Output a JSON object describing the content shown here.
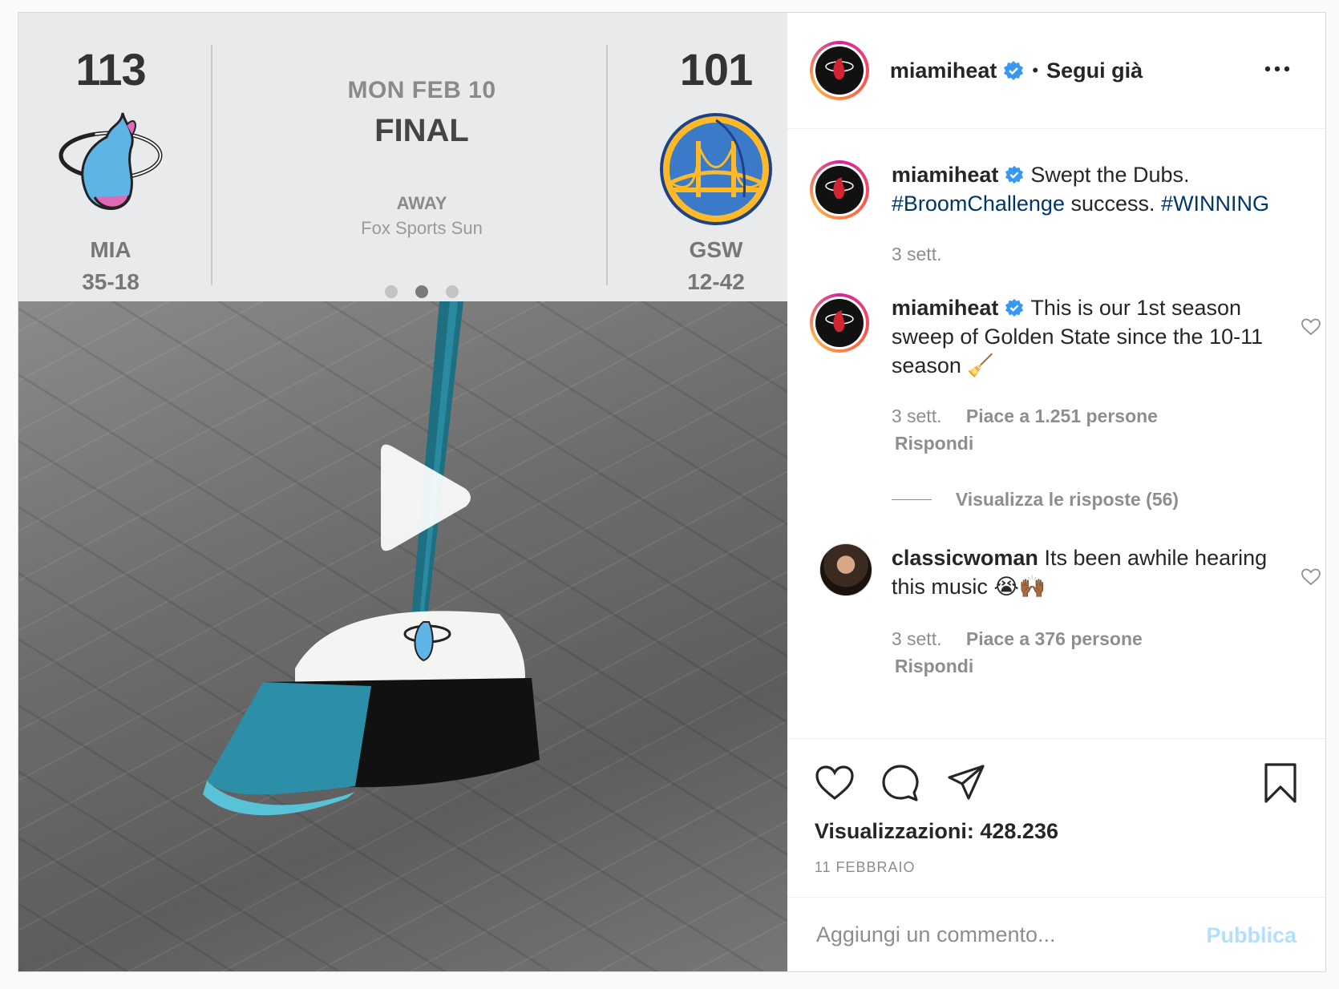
{
  "scoreboard": {
    "home": {
      "score": "113",
      "abbr": "MIA",
      "record": "35-18"
    },
    "away": {
      "score": "101",
      "abbr": "GSW",
      "record": "12-42"
    },
    "date": "MON FEB 10",
    "status": "FINAL",
    "location": "AWAY",
    "tv": "Fox Sports Sun",
    "carousel": {
      "count": 3,
      "active_index": 1
    }
  },
  "header": {
    "username": "miamiheat",
    "separator": "•",
    "follow_label": "Segui già"
  },
  "caption": {
    "username": "miamiheat",
    "text_1": "Swept the Dubs.",
    "hashtag_1": "#BroomChallenge",
    "text_2": "success.",
    "hashtag_2": "#WINNING",
    "time": "3 sett."
  },
  "comments": [
    {
      "username": "miamiheat",
      "text": "This is our 1st season sweep of Golden State since the 10-11 season 🧹",
      "time": "3 sett.",
      "likes": "Piace a 1.251 persone",
      "reply": "Rispondi",
      "view_replies": "Visualizza le risposte (56)"
    },
    {
      "username": "classicwoman",
      "text": "Its been awhile hearing this music 😭🙌🏾",
      "time": "3 sett.",
      "likes": "Piace a 376 persone",
      "reply": "Rispondi"
    }
  ],
  "actions": {
    "icons": [
      "heart-icon",
      "comment-icon",
      "share-icon",
      "bookmark-icon"
    ],
    "views": "Visualizzazioni: 428.236",
    "date": "11 FEBBRAIO"
  },
  "add_comment": {
    "placeholder": "Aggiungi un commento...",
    "publish_label": "Pubblica"
  },
  "colors": {
    "link": "#00376b",
    "verified": "#3897f0",
    "publish_disabled": "#b2dffc",
    "secondary_text": "#8e8e8e"
  }
}
